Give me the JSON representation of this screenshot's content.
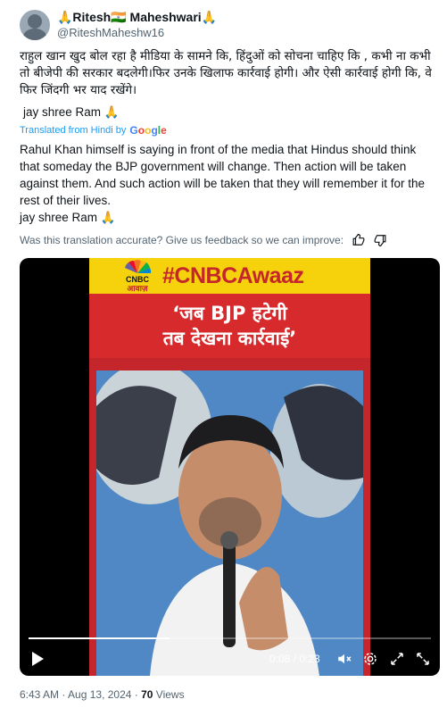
{
  "author": {
    "display_name": "🙏Ritesh🇮🇳 Maheshwari🙏",
    "handle": "@RiteshMaheshw16"
  },
  "tweet": {
    "text_hindi": "राहुल खान खुद बोल रहा है मीडिया के सामने कि, हिंदुओं को सोचना चाहिए कि , कभी ना कभी तो बीजेपी की सरकार बदलेगी।फिर उनके खिलाफ कार्रवाई होगी। और ऐसी कार्रवाई होगी कि, वे फिर जिंदगी भर याद रखेंगे।",
    "sign_off": "jay shree Ram 🙏",
    "translated_label": "Translated from Hindi by",
    "translated_brand": "Google",
    "translation": "Rahul Khan himself is saying in front of the media that Hindus should think that someday the BJP government will change. Then action will be taken against them. And such action will be taken that they will remember it for the rest of their lives.",
    "translation_sign_off": "jay shree Ram 🙏",
    "feedback_prompt": "Was this translation accurate? Give us feedback so we can improve:"
  },
  "video": {
    "channel_tag": "#CNBCAwaaz",
    "logo_text": "CNBC",
    "logo_subtext": "आवाज़",
    "headline_line1": "‘जब BJP हटेगी",
    "headline_line2": "तब देखना कार्रवाई’",
    "progress": 0.35,
    "time_display": "0:08 / 0:23",
    "icons": [
      "play-icon",
      "mute-icon",
      "settings-icon",
      "fullscreen-icon",
      "expand-icon"
    ]
  },
  "meta": {
    "timestamp": "6:43 AM · Aug 13, 2024 · ",
    "views_count": "70",
    "views_label": " Views"
  },
  "colors": {
    "link_blue": "#1d9bf0",
    "secondary": "#536471",
    "cnbc_yellow": "#f5d20c",
    "awaaz_red": "#d72a2d"
  }
}
